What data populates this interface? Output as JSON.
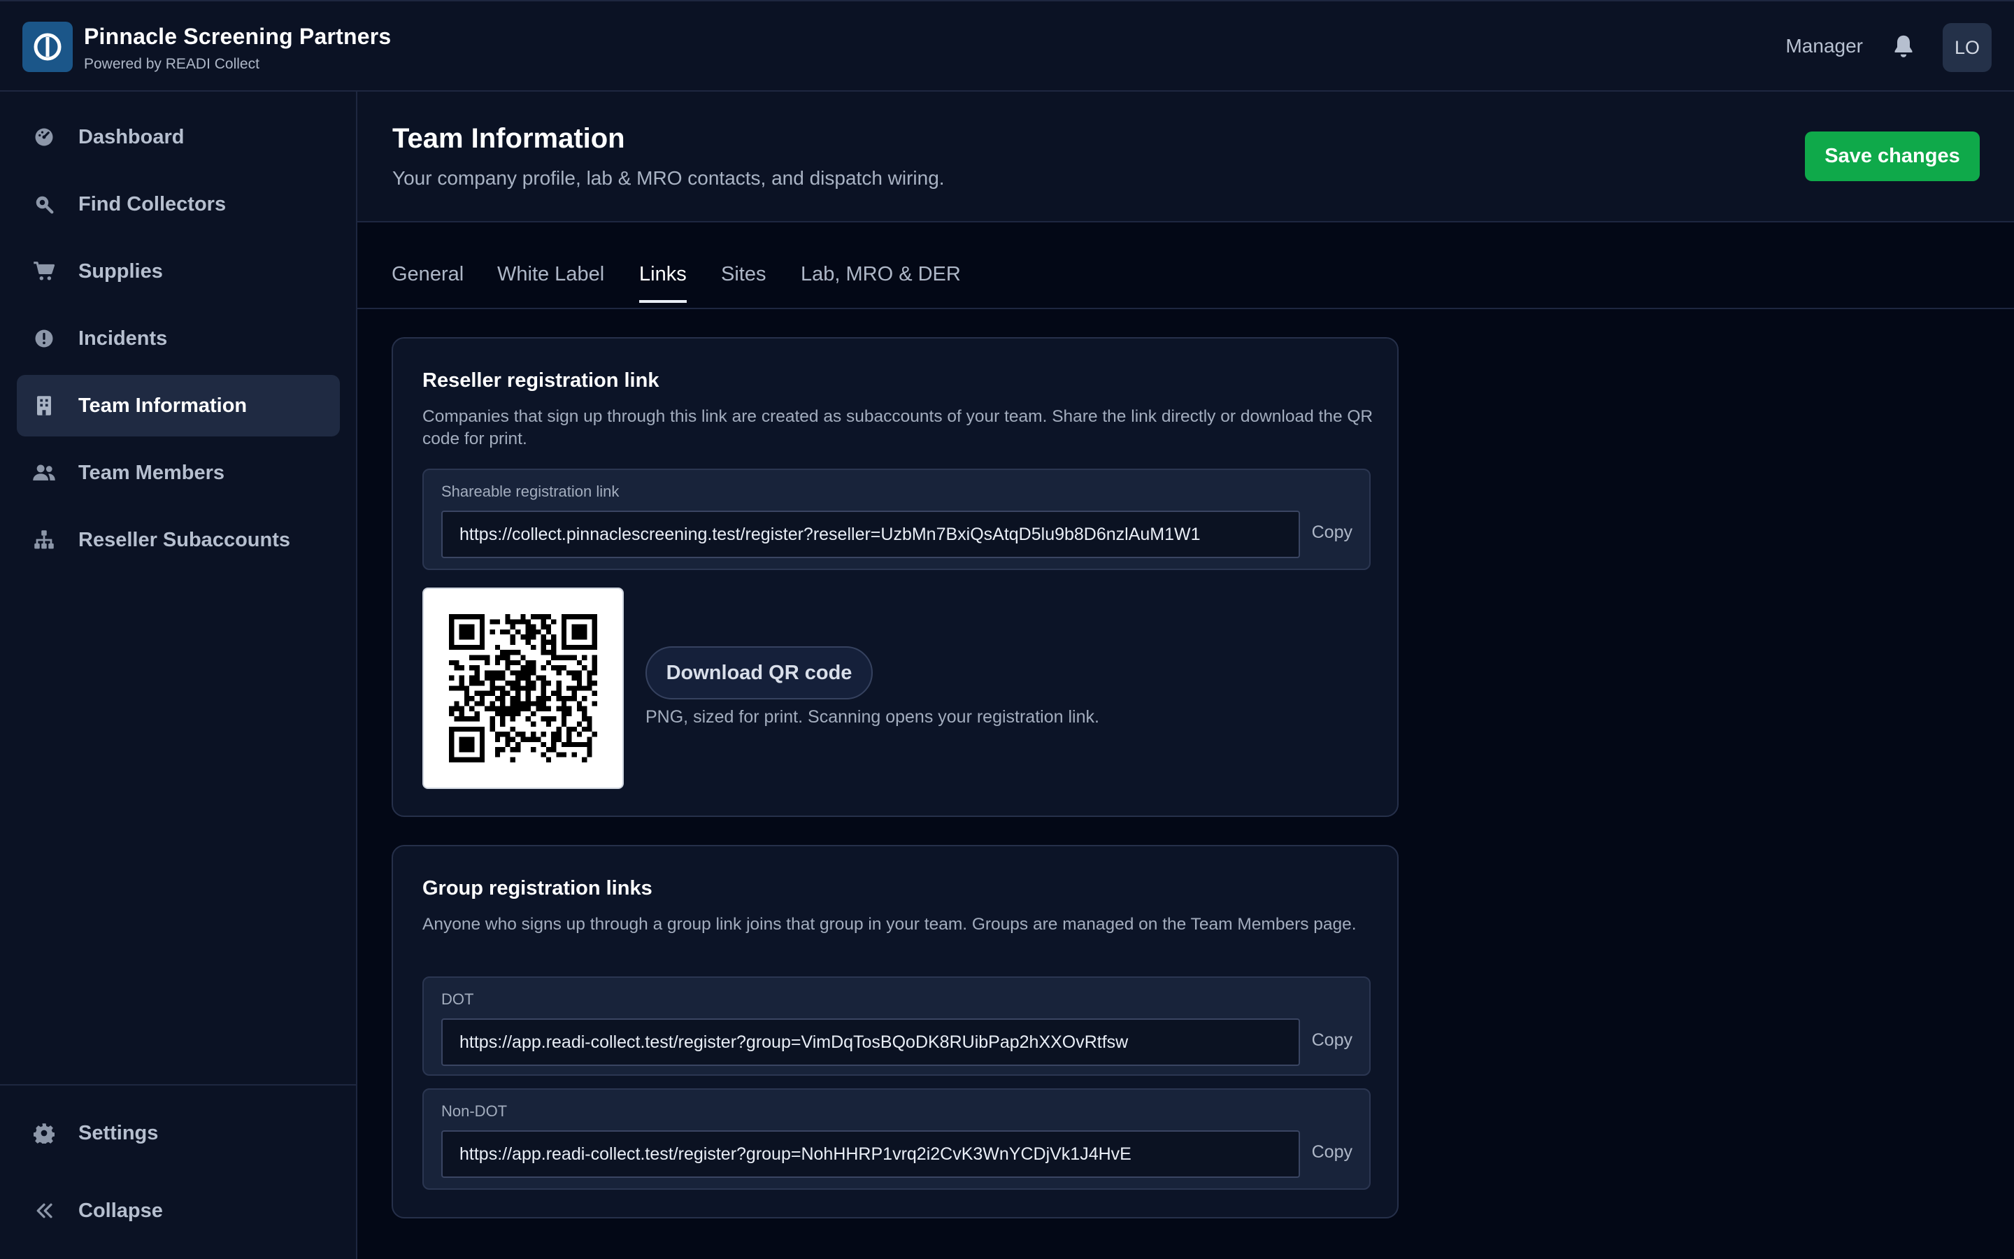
{
  "app": {
    "brand_name": "Pinnacle Screening Partners",
    "brand_sub": "Powered by READI Collect",
    "role": "Manager",
    "avatar_initials": "LO",
    "accent_color": "#0fa94a",
    "logo_color": "#1b5689"
  },
  "sidebar": {
    "items": [
      {
        "label": "Dashboard",
        "icon": "dashboard-icon"
      },
      {
        "label": "Find Collectors",
        "icon": "search-icon"
      },
      {
        "label": "Supplies",
        "icon": "cart-icon"
      },
      {
        "label": "Incidents",
        "icon": "alert-icon"
      },
      {
        "label": "Team Information",
        "icon": "building-icon",
        "active": true
      },
      {
        "label": "Team Members",
        "icon": "users-icon"
      },
      {
        "label": "Reseller Subaccounts",
        "icon": "hierarchy-icon"
      }
    ],
    "footer": [
      {
        "label": "Settings",
        "icon": "gear-icon"
      },
      {
        "label": "Collapse",
        "icon": "collapse-icon"
      }
    ]
  },
  "header": {
    "title": "Team Information",
    "subtitle": "Your company profile, lab & MRO contacts, and dispatch wiring.",
    "save_label": "Save changes"
  },
  "tabs": [
    {
      "label": "General"
    },
    {
      "label": "White Label"
    },
    {
      "label": "Links",
      "active": true
    },
    {
      "label": "Sites"
    },
    {
      "label": "Lab, MRO & DER"
    }
  ],
  "reseller": {
    "title": "Reseller registration link",
    "description": "Companies that sign up through this link are created as subaccounts of your team. Share the link directly or download the QR code for print.",
    "link_label": "Shareable registration link",
    "link_value": "https://collect.pinnaclescreening.test/register?reseller=UzbMn7BxiQsAtqD5lu9b8D6nzlAuM1W1",
    "copy_label": "Copy",
    "download_label": "Download QR code",
    "download_hint": "PNG, sized for print. Scanning opens your registration link."
  },
  "groups": {
    "title": "Group registration links",
    "description": "Anyone who signs up through a group link joins that group in your team. Groups are managed on the Team Members page.",
    "links": [
      {
        "label": "DOT",
        "value": "https://app.readi-collect.test/register?group=VimDqTosBQoDK8RUibPap2hXXOvRtfsw",
        "copy": "Copy"
      },
      {
        "label": "Non-DOT",
        "value": "https://app.readi-collect.test/register?group=NohHHRP1vrq2i2CvK3WnYCDjVk1J4HvE",
        "copy": "Copy"
      }
    ]
  }
}
